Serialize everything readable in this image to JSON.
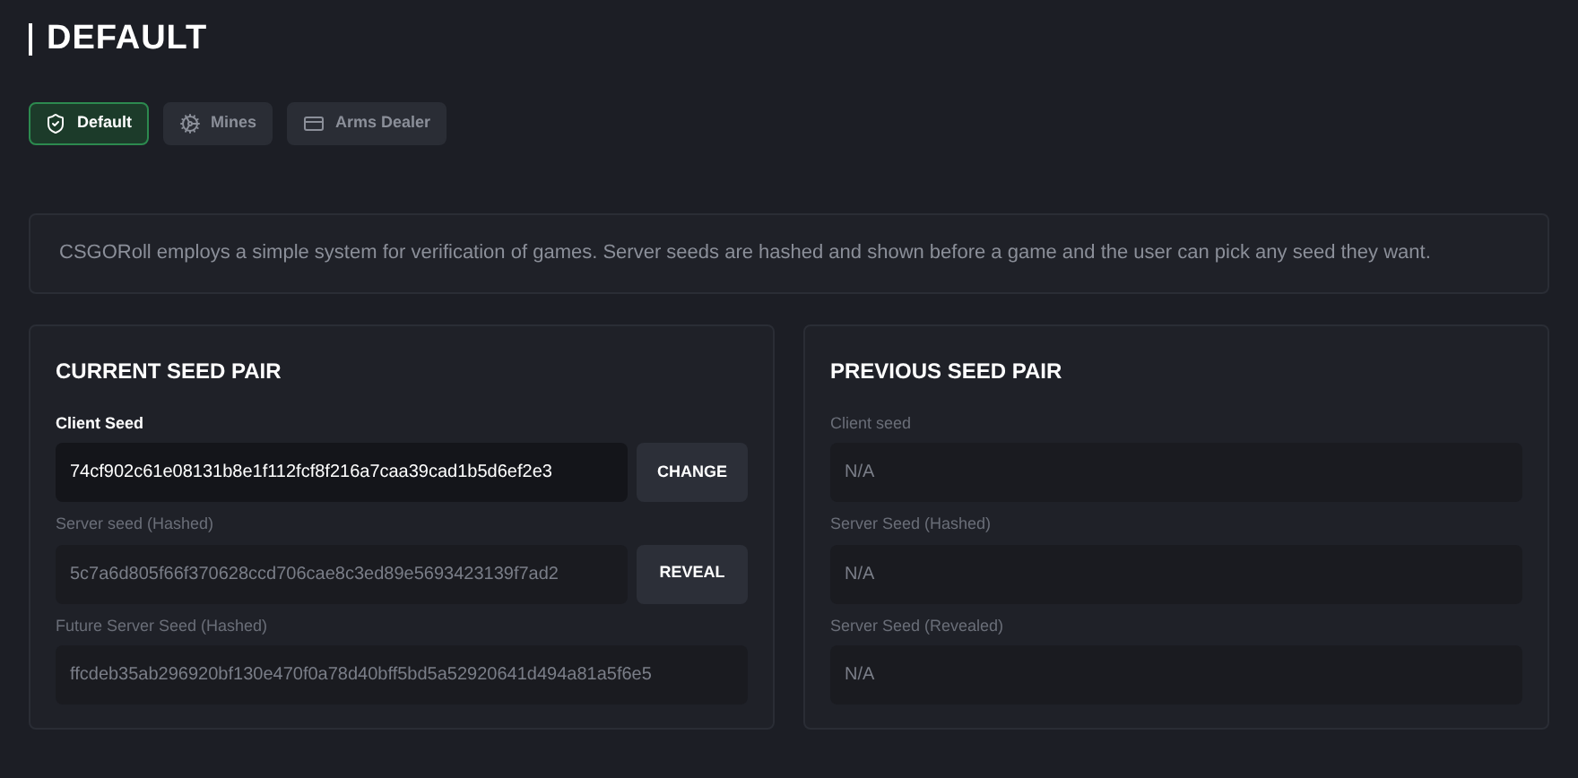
{
  "title": "DEFAULT",
  "tabs": [
    {
      "label": "Default",
      "kind": "shield",
      "selected": true
    },
    {
      "label": "Mines",
      "kind": "mine",
      "selected": false
    },
    {
      "label": "Arms Dealer",
      "kind": "card",
      "selected": false
    }
  ],
  "intro": "CSGORoll employs a simple system for verification of games. Server seeds are hashed and shown before a game and the user can pick any seed they want.",
  "panels": [
    {
      "title": "CURRENT SEED PAIR",
      "fields": [
        {
          "label": "Client Seed",
          "value": "74cf902c61e08131b8e1f112fcf8f216a7caa39cad1b5d6ef2e3",
          "disabled": false,
          "button": "CHANGE"
        },
        {
          "label": "Server seed (Hashed)",
          "value": "5c7a6d805f66f370628ccd706cae8c3ed89e5693423139f7ad2",
          "disabled": true,
          "button": "REVEAL"
        },
        {
          "label": "Future Server Seed (Hashed)",
          "value": "ffcdeb35ab296920bf130e470f0a78d40bff5bd5a52920641d494a81a5f6e5",
          "disabled": true
        }
      ]
    },
    {
      "title": "PREVIOUS SEED PAIR",
      "fields": [
        {
          "label": "Client seed",
          "value": "N/A",
          "disabled": true
        },
        {
          "label": "Server Seed (Hashed)",
          "value": "N/A",
          "disabled": true
        },
        {
          "label": "Server Seed (Revealed)",
          "value": "N/A",
          "disabled": true
        }
      ]
    }
  ]
}
